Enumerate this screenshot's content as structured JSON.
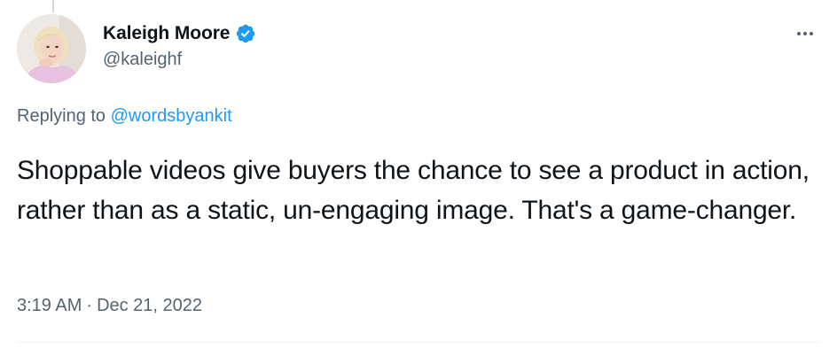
{
  "author": {
    "display_name": "Kaleigh Moore",
    "handle": "@kaleighf",
    "verified": true
  },
  "reply": {
    "prefix": "Replying to ",
    "mention": "@wordsbyankit"
  },
  "tweet": {
    "text": "Shoppable videos give buyers the chance to see a product in action, rather than as a static, un-engaging image. That's a game-changer."
  },
  "meta": {
    "time": "3:19 AM",
    "separator": "·",
    "date": "Dec 21, 2022"
  },
  "icons": {
    "verified": "verified-badge-icon",
    "more": "more-options-icon"
  },
  "colors": {
    "accent": "#1d9bf0",
    "text_primary": "#0f1419",
    "text_secondary": "#536471",
    "divider": "#eff3f4"
  }
}
